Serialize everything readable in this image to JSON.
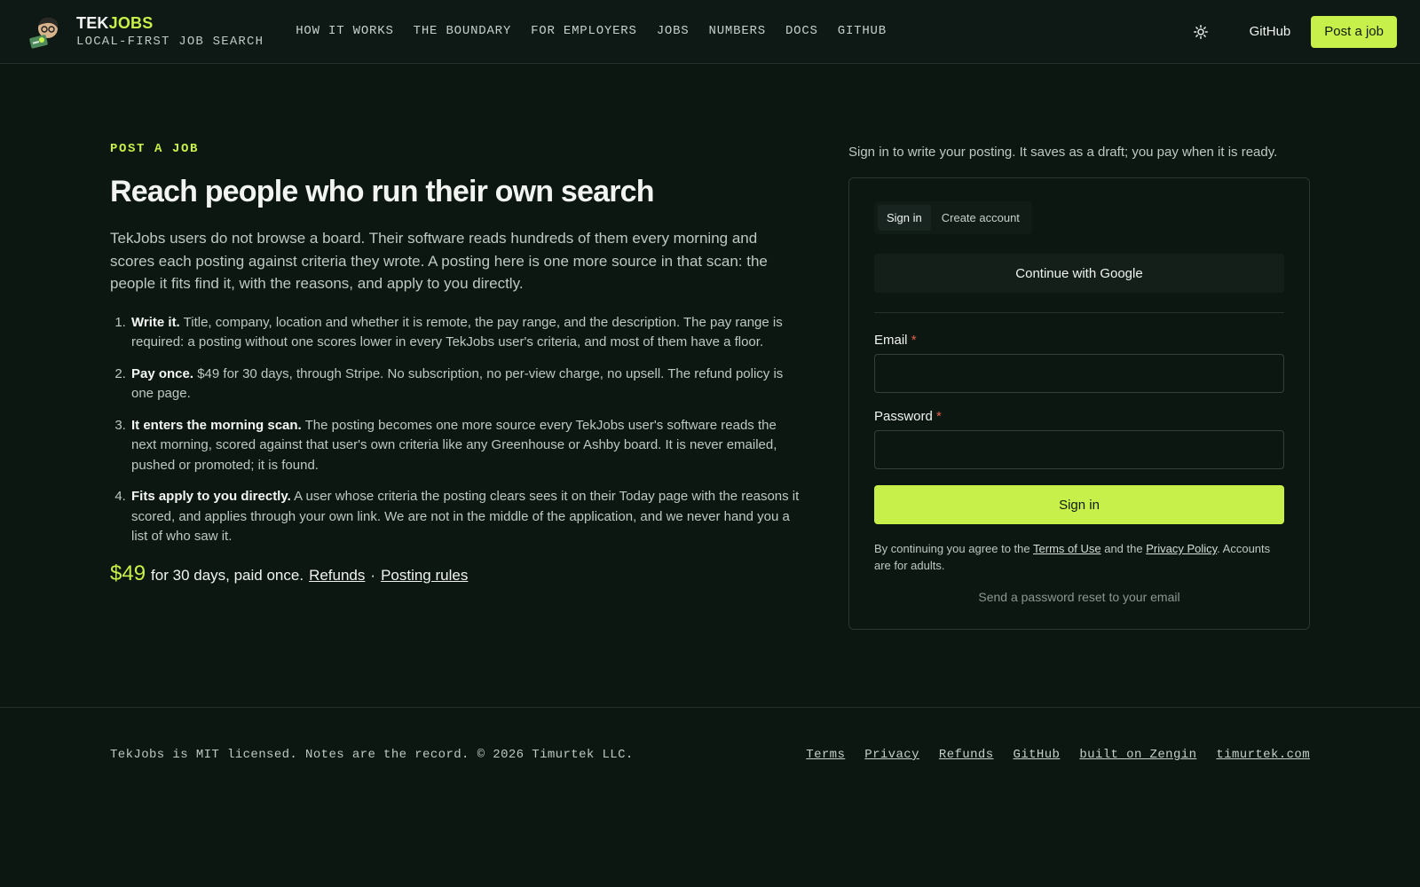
{
  "header": {
    "brand_prefix": "TEK",
    "brand_suffix": "JOBS",
    "tagline": "LOCAL-FIRST JOB SEARCH",
    "nav": [
      {
        "label": "HOW IT WORKS"
      },
      {
        "label": "THE BOUNDARY"
      },
      {
        "label": "FOR EMPLOYERS"
      },
      {
        "label": "JOBS"
      },
      {
        "label": "NUMBERS"
      },
      {
        "label": "DOCS"
      },
      {
        "label": "GITHUB"
      }
    ],
    "theme_icon": "sun-icon",
    "github_label": "GitHub",
    "post_job_label": "Post a job"
  },
  "main": {
    "eyebrow": "POST A JOB",
    "headline": "Reach people who run their own search",
    "lead": "TekJobs users do not browse a board. Their software reads hundreds of them every morning and scores each posting against criteria they wrote. A posting here is one more source in that scan: the people it fits find it, with the reasons, and apply to you directly.",
    "steps": [
      {
        "title": "Write it.",
        "body": "Title, company, location and whether it is remote, the pay range, and the description. The pay range is required: a posting without one scores lower in every TekJobs user's criteria, and most of them have a floor."
      },
      {
        "title": "Pay once.",
        "body": "$49 for 30 days, through Stripe. No subscription, no per-view charge, no upsell. The refund policy is one page."
      },
      {
        "title": "It enters the morning scan.",
        "body": "The posting becomes one more source every TekJobs user's software reads the next morning, scored against that user's own criteria like any Greenhouse or Ashby board. It is never emailed, pushed or promoted; it is found."
      },
      {
        "title": "Fits apply to you directly.",
        "body": "A user whose criteria the posting clears sees it on their Today page with the reasons it scored, and applies through your own link. We are not in the middle of the application, and we never hand you a list of who saw it."
      }
    ],
    "price": "$49",
    "price_text": "for 30 days, paid once.",
    "refunds_link": "Refunds",
    "separator": "·",
    "rules_link": "Posting rules"
  },
  "auth": {
    "intro": "Sign in to write your posting. It saves as a draft; you pay when it is ready.",
    "tabs": [
      {
        "label": "Sign in",
        "active": true
      },
      {
        "label": "Create account",
        "active": false
      }
    ],
    "google_label": "Continue with Google",
    "email_label": "Email",
    "email_value": "",
    "password_label": "Password",
    "password_value": "",
    "required_mark": "*",
    "submit_label": "Sign in",
    "legal_prefix": "By continuing you agree to the",
    "terms_link": "Terms of Use",
    "legal_and": "and the",
    "privacy_link": "Privacy Policy",
    "legal_suffix": ". Accounts are for adults.",
    "reset_label": "Send a password reset to your email"
  },
  "footer": {
    "text": "TekJobs is MIT licensed. Notes are the record. © 2026 Timurtek LLC.",
    "links": [
      {
        "label": "Terms"
      },
      {
        "label": "Privacy"
      },
      {
        "label": "Refunds"
      },
      {
        "label": "GitHub"
      },
      {
        "label": "built on Zengin"
      },
      {
        "label": "timurtek.com"
      }
    ]
  },
  "colors": {
    "background": "#0c1712",
    "accent": "#c8f04a",
    "required": "#e0604b"
  }
}
